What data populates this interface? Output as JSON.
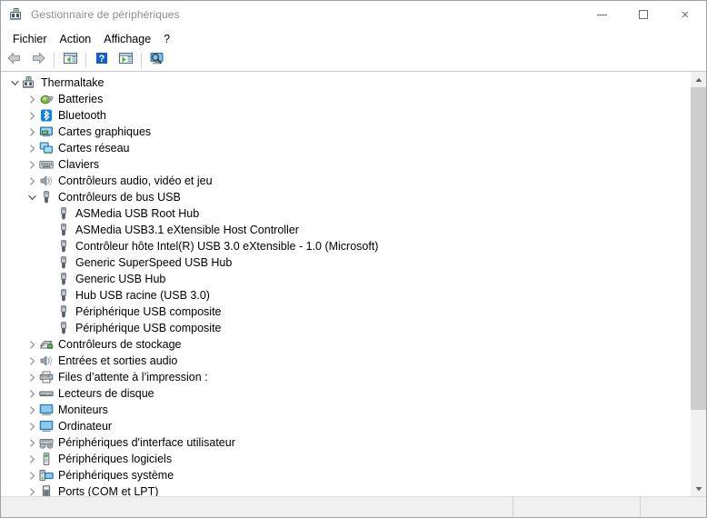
{
  "window": {
    "title": "Gestionnaire de périphériques",
    "title_icon": "device-manager-icon",
    "minimize_label": "Réduire",
    "maximize_label": "Agrandir",
    "close_label": "Fermer",
    "close_glyph": "✕"
  },
  "menubar": {
    "items": [
      {
        "label": "Fichier",
        "name": "menu-fichier"
      },
      {
        "label": "Action",
        "name": "menu-action"
      },
      {
        "label": "Affichage",
        "name": "menu-affichage"
      },
      {
        "label": "?",
        "name": "menu-aide"
      }
    ]
  },
  "toolbar": {
    "buttons": [
      {
        "name": "back-button",
        "icon": "back-arrow-icon",
        "tooltip": "Précédent"
      },
      {
        "name": "forward-button",
        "icon": "forward-arrow-icon",
        "tooltip": "Suivant"
      },
      {
        "name": "properties-button",
        "icon": "properties-icon",
        "tooltip": "Propriétés"
      },
      {
        "name": "help-button",
        "icon": "help-question-icon",
        "tooltip": "Aide"
      },
      {
        "name": "update-driver-button",
        "icon": "update-driver-icon",
        "tooltip": "Mettre à jour le pilote"
      },
      {
        "name": "scan-hardware-button",
        "icon": "scan-monitor-icon",
        "tooltip": "Rechercher les modifications sur le matériel"
      }
    ]
  },
  "tree": {
    "nodes": [
      {
        "label": "Thermaltake",
        "level": 0,
        "state": "expanded",
        "icon": "computer-device-icon"
      },
      {
        "label": "Batteries",
        "level": 1,
        "state": "collapsed",
        "icon": "battery-icon"
      },
      {
        "label": "Bluetooth",
        "level": 1,
        "state": "collapsed",
        "icon": "bluetooth-icon"
      },
      {
        "label": "Cartes graphiques",
        "level": 1,
        "state": "collapsed",
        "icon": "display-adapter-icon"
      },
      {
        "label": "Cartes réseau",
        "level": 1,
        "state": "collapsed",
        "icon": "network-adapter-icon"
      },
      {
        "label": "Claviers",
        "level": 1,
        "state": "collapsed",
        "icon": "keyboard-icon"
      },
      {
        "label": "Contrôleurs audio, vidéo et jeu",
        "level": 1,
        "state": "collapsed",
        "icon": "speaker-icon"
      },
      {
        "label": "Contrôleurs de bus USB",
        "level": 1,
        "state": "expanded",
        "icon": "usb-icon"
      },
      {
        "label": "ASMedia USB Root Hub",
        "level": 2,
        "state": "leaf",
        "icon": "usb-icon"
      },
      {
        "label": "ASMedia USB3.1 eXtensible Host Controller",
        "level": 2,
        "state": "leaf",
        "icon": "usb-icon"
      },
      {
        "label": "Contrôleur hôte Intel(R) USB 3.0 eXtensible - 1.0 (Microsoft)",
        "level": 2,
        "state": "leaf",
        "icon": "usb-icon"
      },
      {
        "label": "Generic SuperSpeed USB Hub",
        "level": 2,
        "state": "leaf",
        "icon": "usb-icon"
      },
      {
        "label": "Generic USB Hub",
        "level": 2,
        "state": "leaf",
        "icon": "usb-icon"
      },
      {
        "label": "Hub USB racine (USB 3.0)",
        "level": 2,
        "state": "leaf",
        "icon": "usb-icon"
      },
      {
        "label": "Périphérique USB composite",
        "level": 2,
        "state": "leaf",
        "icon": "usb-icon"
      },
      {
        "label": "Périphérique USB composite",
        "level": 2,
        "state": "leaf",
        "icon": "usb-icon"
      },
      {
        "label": "Contrôleurs de stockage",
        "level": 1,
        "state": "collapsed",
        "icon": "storage-controller-icon"
      },
      {
        "label": "Entrées et sorties audio",
        "level": 1,
        "state": "collapsed",
        "icon": "speaker-icon"
      },
      {
        "label": "Files d’attente à l’impression :",
        "level": 1,
        "state": "collapsed",
        "icon": "printer-icon"
      },
      {
        "label": "Lecteurs de disque",
        "level": 1,
        "state": "collapsed",
        "icon": "disk-drive-icon"
      },
      {
        "label": "Moniteurs",
        "level": 1,
        "state": "collapsed",
        "icon": "monitor-icon"
      },
      {
        "label": "Ordinateur",
        "level": 1,
        "state": "collapsed",
        "icon": "monitor-icon"
      },
      {
        "label": "Périphériques d'interface utilisateur",
        "level": 1,
        "state": "collapsed",
        "icon": "hid-gamepad-icon"
      },
      {
        "label": "Périphériques logiciels",
        "level": 1,
        "state": "collapsed",
        "icon": "software-device-icon"
      },
      {
        "label": "Périphériques système",
        "level": 1,
        "state": "collapsed",
        "icon": "system-device-icon"
      },
      {
        "label": "Ports (COM et LPT)",
        "level": 1,
        "state": "collapsed",
        "icon": "port-icon"
      }
    ]
  },
  "scrollbar": {
    "up_glyph": "▲",
    "down_glyph": "▼",
    "thumb_top_percent": 0,
    "thumb_height_percent": 82
  },
  "statusbar": {
    "panes": [
      {
        "text": "",
        "name": "status-pane-main"
      },
      {
        "text": "",
        "name": "status-pane-secondary"
      },
      {
        "text": "",
        "name": "status-pane-tertiary"
      }
    ]
  },
  "colors": {
    "accent_blue": "#0078d7",
    "bluetooth_blue": "#1683d8",
    "window_bg": "#ffffff",
    "status_bg": "#f0f0f0",
    "scroll_thumb": "#cdcdcd"
  }
}
